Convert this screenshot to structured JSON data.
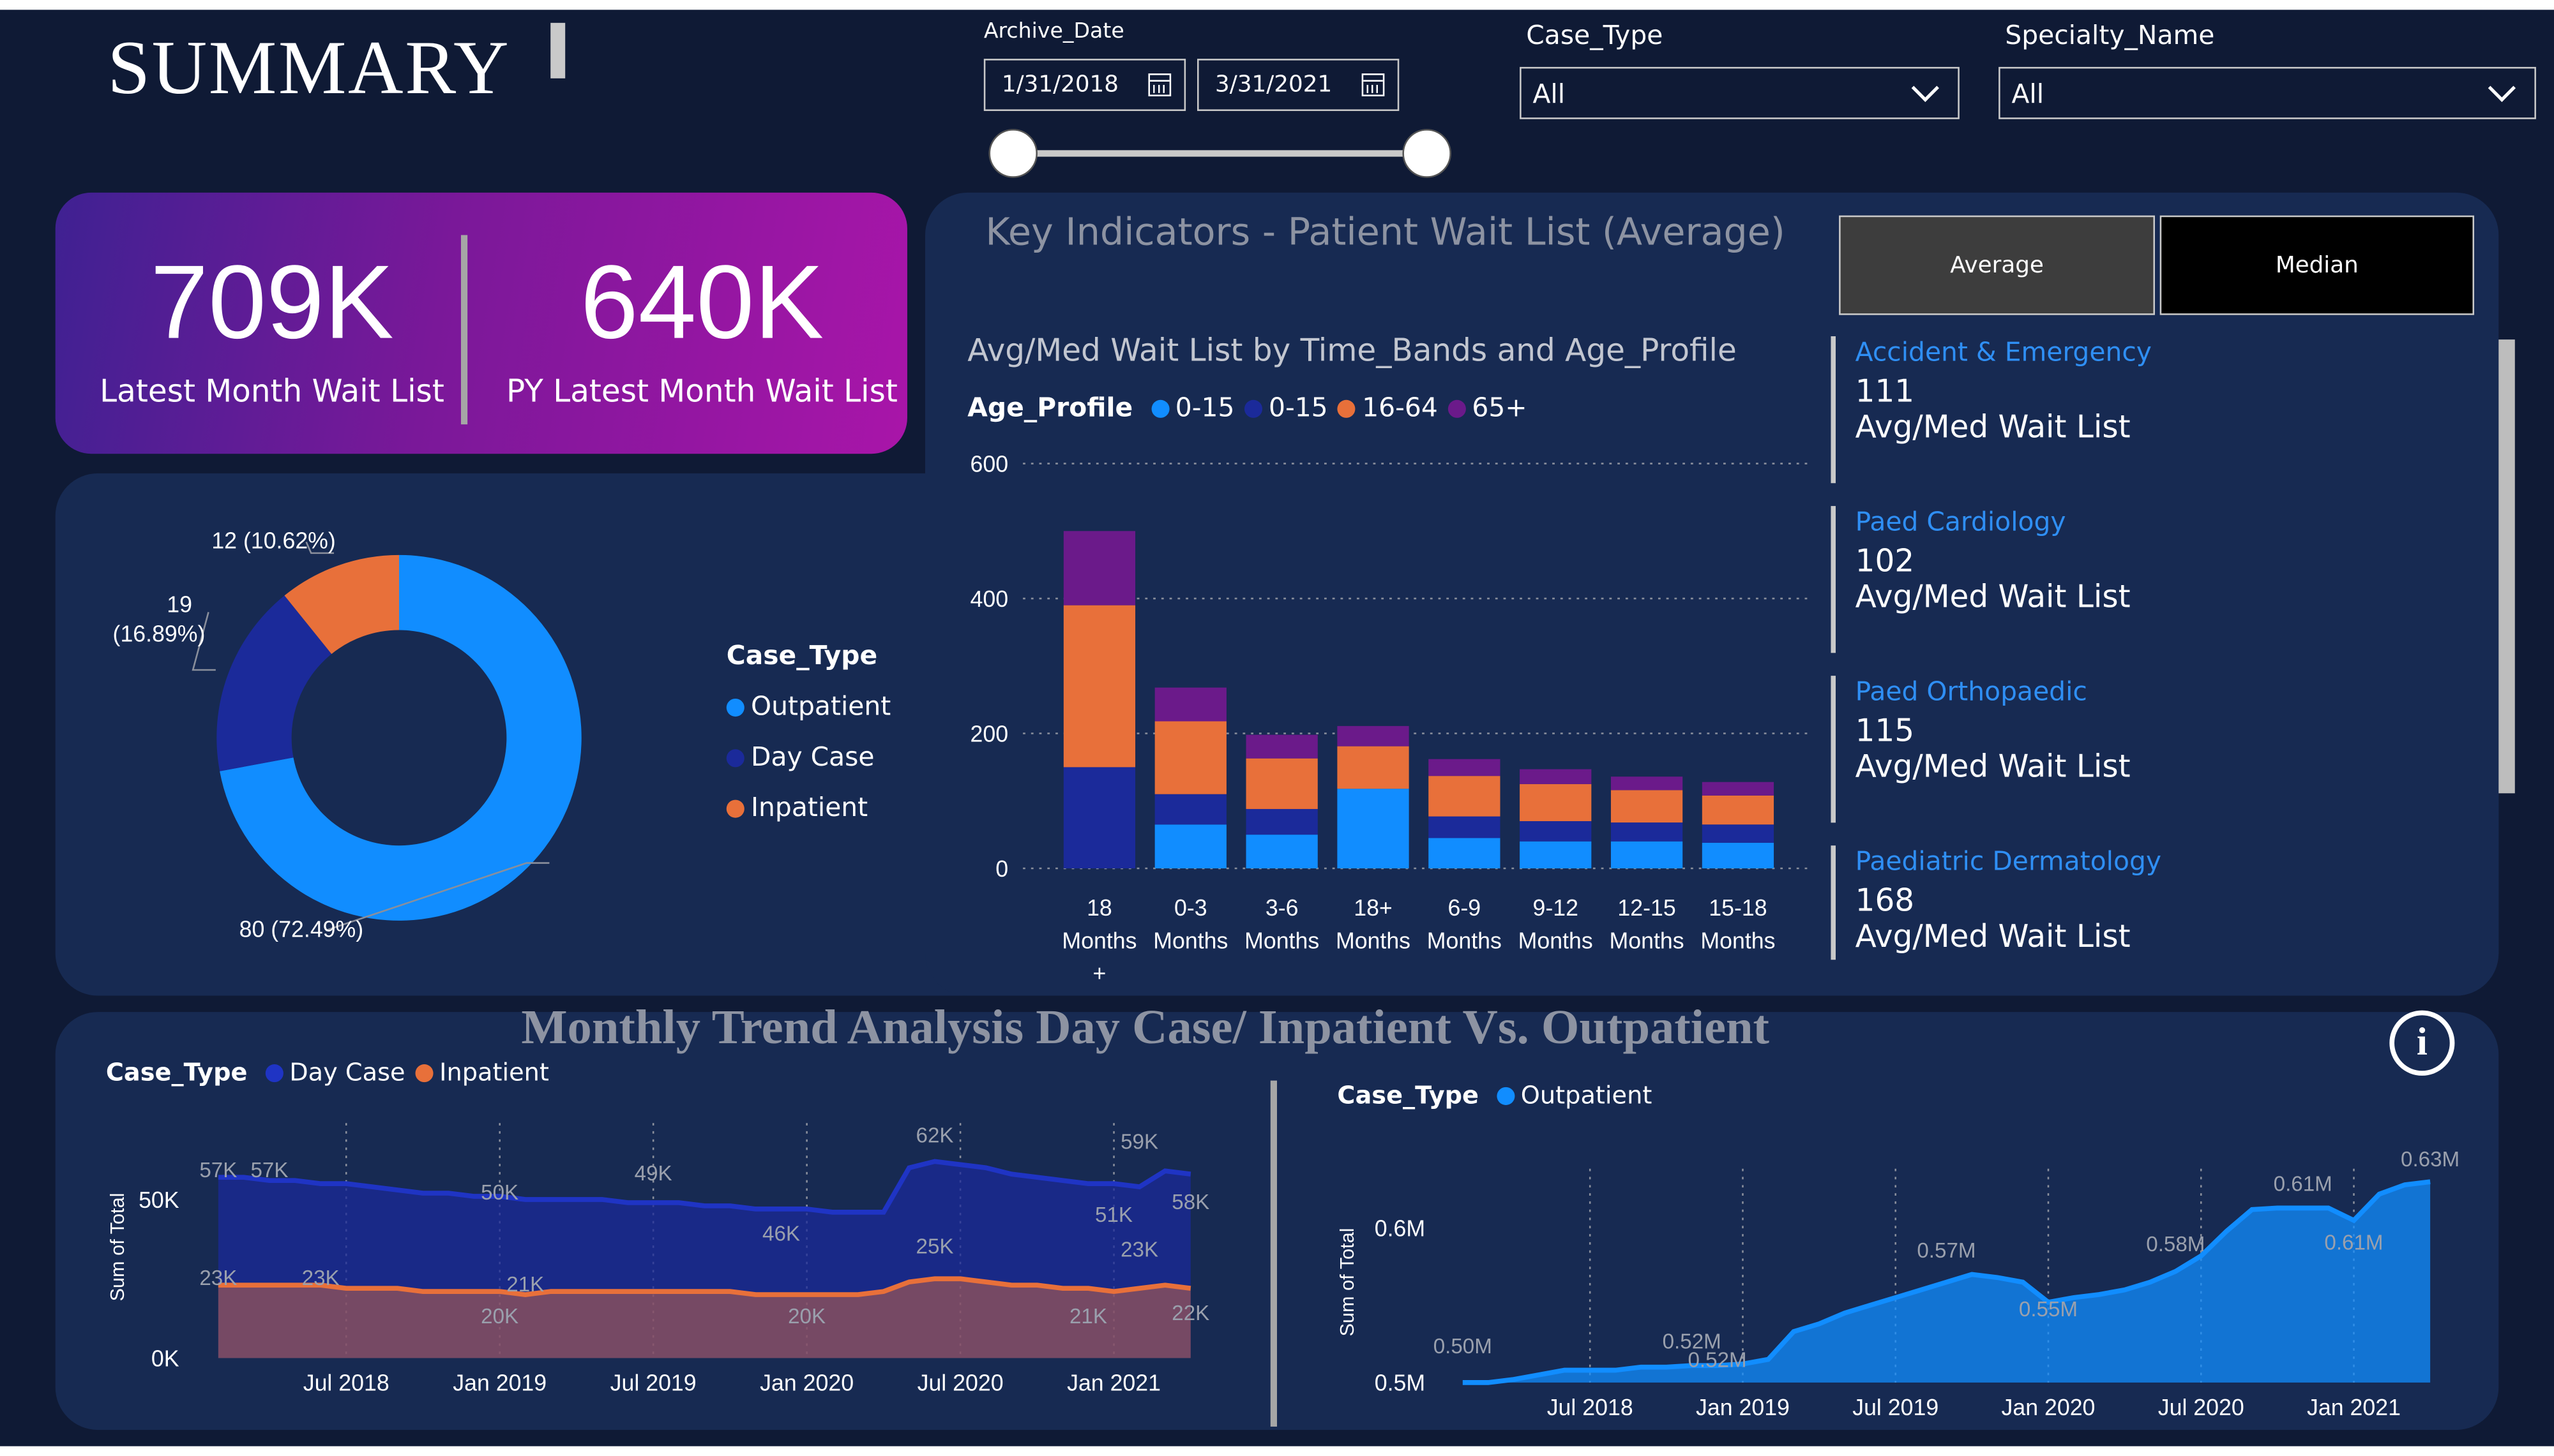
{
  "header": {
    "title": "SUMMARY"
  },
  "filters": {
    "archive_date": {
      "label": "Archive_Date",
      "start": "1/31/2018",
      "end": "3/31/2021",
      "slider_start": 0.0,
      "slider_end": 1.0
    },
    "case_type": {
      "label": "Case_Type",
      "value": "All"
    },
    "specialty": {
      "label": "Specialty_Name",
      "value": "All"
    }
  },
  "kpis": {
    "latest": {
      "value": "709K",
      "label": "Latest Month Wait List"
    },
    "py_latest": {
      "value": "640K",
      "label": "PY Latest Month Wait List"
    }
  },
  "key_indicators": {
    "title": "Key Indicators - Patient Wait List (Average)",
    "buttons": {
      "average": "Average",
      "median": "Median"
    }
  },
  "specialties": [
    {
      "name": "Accident & Emergency",
      "value": "111",
      "label": "Avg/Med Wait List"
    },
    {
      "name": "Paed Cardiology",
      "value": "102",
      "label": "Avg/Med Wait List"
    },
    {
      "name": "Paed Orthopaedic",
      "value": "115",
      "label": "Avg/Med Wait List"
    },
    {
      "name": "Paediatric Dermatology",
      "value": "168",
      "label": "Avg/Med Wait List"
    }
  ],
  "trend_section": {
    "title": "Monthly Trend Analysis Day Case/ Inpatient Vs. Outpatient",
    "info_icon": "info-icon"
  },
  "colors": {
    "background": "#0f1a35",
    "card": "#172a52",
    "outpatient": "#118dff",
    "day_case": "#1b2a9a",
    "inpatient": "#e8703a",
    "age_65": "#6b1a8a",
    "accent_text": "#2f8ff5"
  },
  "chart_data": [
    {
      "type": "pie",
      "legend_title": "Case_Type",
      "legend_position": "right",
      "slices": [
        {
          "name": "Outpatient",
          "value": 80,
          "label": "80 (72.49%)",
          "color": "#118dff"
        },
        {
          "name": "Day Case",
          "value": 19,
          "label": "19 (16.89%)",
          "color": "#1b2a9a"
        },
        {
          "name": "Inpatient",
          "value": 12,
          "label": "12 (10.62%)",
          "color": "#e8703a"
        }
      ]
    },
    {
      "type": "bar",
      "stacked": true,
      "title": "Avg/Med Wait List by Time_Bands and Age_Profile",
      "legend_title": "Age_Profile",
      "legend_position": "top-left",
      "categories": [
        "18 Months +",
        "0-3 Months",
        "3-6 Months",
        "18+ Months",
        "6-9 Months",
        "9-12 Months",
        "12-15 Months",
        "15-18 Months"
      ],
      "category_lines": [
        [
          "18",
          "Months",
          "+"
        ],
        [
          "0-3",
          "Months"
        ],
        [
          "3-6",
          "Months"
        ],
        [
          "18+",
          "Months"
        ],
        [
          "6-9",
          "Months"
        ],
        [
          "9-12",
          "Months"
        ],
        [
          "12-15",
          "Months"
        ],
        [
          "15-18",
          "Months"
        ]
      ],
      "series": [
        {
          "name": "0-15",
          "color": "#118dff",
          "values": [
            0,
            65,
            50,
            118,
            45,
            40,
            40,
            38
          ]
        },
        {
          "name": "0-15",
          "color": "#1b2a9a",
          "values": [
            150,
            45,
            38,
            0,
            32,
            30,
            28,
            27
          ]
        },
        {
          "name": "16-64",
          "color": "#e8703a",
          "values": [
            240,
            108,
            75,
            63,
            60,
            55,
            48,
            43
          ]
        },
        {
          "name": "65+",
          "color": "#6b1a8a",
          "values": [
            110,
            50,
            35,
            30,
            25,
            22,
            20,
            20
          ]
        }
      ],
      "yticks": [
        "0",
        "200",
        "400",
        "600"
      ],
      "ylim": [
        0,
        600
      ],
      "grid": true
    },
    {
      "type": "area",
      "legend_title": "Case_Type",
      "legend_position": "top-left",
      "ylabel": "Sum of Total",
      "xticks": [
        "Jul 2018",
        "Jan 2019",
        "Jul 2019",
        "Jan 2020",
        "Jul 2020",
        "Jan 2021"
      ],
      "yticks": [
        "0K",
        "50K"
      ],
      "ylim": [
        0,
        70
      ],
      "x_range": [
        0,
        38
      ],
      "xtick_positions": [
        5,
        11,
        17,
        23,
        29,
        35
      ],
      "series": [
        {
          "name": "Day Case",
          "color": "#1b2a9a",
          "values": [
            57,
            57,
            56,
            56,
            55,
            55,
            54,
            53,
            52,
            52,
            51,
            51,
            50,
            50,
            50,
            50,
            49,
            49,
            49,
            48,
            48,
            47,
            47,
            47,
            46,
            46,
            46,
            60,
            62,
            61,
            60,
            58,
            57,
            56,
            55,
            55,
            54,
            59,
            58
          ]
        },
        {
          "name": "Inpatient",
          "color": "#e8703a",
          "values": [
            23,
            23,
            23,
            23,
            23,
            22,
            22,
            22,
            21,
            21,
            21,
            21,
            20,
            21,
            21,
            21,
            21,
            21,
            21,
            21,
            21,
            20,
            20,
            20,
            20,
            20,
            21,
            24,
            25,
            25,
            24,
            23,
            23,
            22,
            22,
            21,
            22,
            23,
            22
          ]
        }
      ],
      "data_labels": [
        {
          "text": "57K",
          "i": 0,
          "v": 57
        },
        {
          "text": "57K",
          "i": 2,
          "v": 57
        },
        {
          "text": "23K",
          "i": 0,
          "v": 23
        },
        {
          "text": "23K",
          "i": 4,
          "v": 23
        },
        {
          "text": "50K",
          "i": 11,
          "v": 50
        },
        {
          "text": "21K",
          "i": 12,
          "v": 21
        },
        {
          "text": "20K",
          "i": 11,
          "v": 11
        },
        {
          "text": "49K",
          "i": 17,
          "v": 56
        },
        {
          "text": "46K",
          "i": 22,
          "v": 37
        },
        {
          "text": "20K",
          "i": 23,
          "v": 11
        },
        {
          "text": "62K",
          "i": 28,
          "v": 68
        },
        {
          "text": "25K",
          "i": 28,
          "v": 33
        },
        {
          "text": "59K",
          "i": 36,
          "v": 66
        },
        {
          "text": "51K",
          "i": 35,
          "v": 43
        },
        {
          "text": "23K",
          "i": 36,
          "v": 32
        },
        {
          "text": "21K",
          "i": 34,
          "v": 11
        },
        {
          "text": "58K",
          "i": 38,
          "v": 47
        },
        {
          "text": "22K",
          "i": 38,
          "v": 12
        }
      ]
    },
    {
      "type": "area",
      "legend_title": "Case_Type",
      "legend_position": "top-left",
      "ylabel": "Sum of Total",
      "xticks": [
        "Jul 2018",
        "Jan 2019",
        "Jul 2019",
        "Jan 2020",
        "Jul 2020",
        "Jan 2021"
      ],
      "yticks": [
        "0.5M",
        "0.6M"
      ],
      "ylim": [
        0.5,
        0.63
      ],
      "x_range": [
        0,
        38
      ],
      "xtick_positions": [
        5,
        11,
        17,
        23,
        29,
        35
      ],
      "series": [
        {
          "name": "Outpatient",
          "color": "#118dff",
          "values": [
            0.5,
            0.5,
            0.502,
            0.505,
            0.508,
            0.508,
            0.508,
            0.51,
            0.51,
            0.511,
            0.511,
            0.512,
            0.515,
            0.533,
            0.538,
            0.545,
            0.55,
            0.555,
            0.56,
            0.565,
            0.57,
            0.568,
            0.565,
            0.552,
            0.555,
            0.557,
            0.56,
            0.565,
            0.572,
            0.582,
            0.598,
            0.612,
            0.613,
            0.613,
            0.613,
            0.605,
            0.622,
            0.628,
            0.63
          ]
        }
      ],
      "data_labels": [
        {
          "text": "0.50M",
          "i": 0,
          "v": 0.519
        },
        {
          "text": "0.52M",
          "i": 9,
          "v": 0.522
        },
        {
          "text": "0.52M",
          "i": 10,
          "v": 0.51
        },
        {
          "text": "0.57M",
          "i": 19,
          "v": 0.581
        },
        {
          "text": "0.55M",
          "i": 23,
          "v": 0.543
        },
        {
          "text": "0.58M",
          "i": 28,
          "v": 0.585
        },
        {
          "text": "0.61M",
          "i": 33,
          "v": 0.624
        },
        {
          "text": "0.61M",
          "i": 35,
          "v": 0.586
        },
        {
          "text": "0.63M",
          "i": 38,
          "v": 0.64
        }
      ]
    }
  ]
}
